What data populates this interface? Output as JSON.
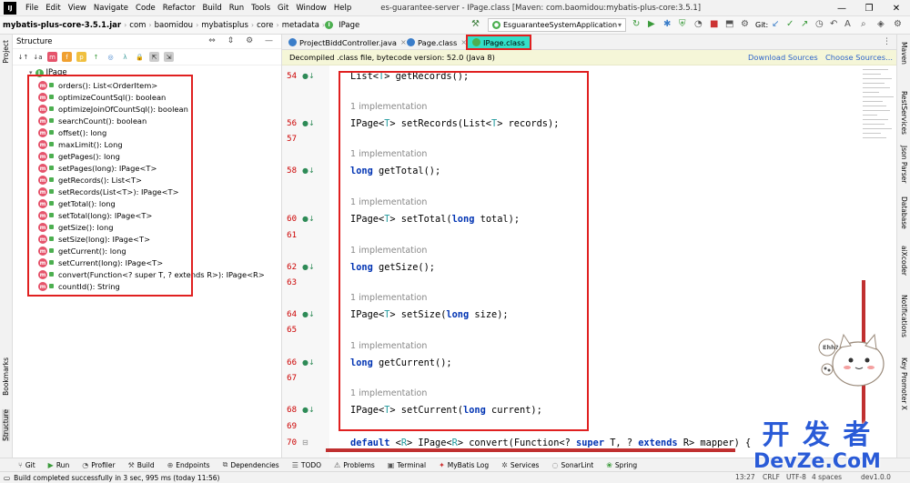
{
  "window": {
    "title": "es-guarantee-server - IPage.class [Maven: com.baomidou:mybatis-plus-core:3.5.1]",
    "menu": [
      "File",
      "Edit",
      "View",
      "Navigate",
      "Code",
      "Refactor",
      "Build",
      "Run",
      "Tools",
      "Git",
      "Window",
      "Help"
    ],
    "controls": [
      "—",
      "❐",
      "✕"
    ]
  },
  "breadcrumb": [
    "mybatis-plus-core-3.5.1.jar",
    "com",
    "baomidou",
    "mybatisplus",
    "core",
    "metadata",
    "IPage"
  ],
  "run_config": "EsguaranteeSystemApplication",
  "git_label": "Git:",
  "left_strip": [
    "Project",
    "Bookmarks",
    "Structure"
  ],
  "right_strip": [
    "Maven",
    "RestServices",
    "Json Parser",
    "Database",
    "aiXcoder",
    "Notifications",
    "Key Promoter X"
  ],
  "structure": {
    "title": "Structure",
    "root": "IPage",
    "methods": [
      "orders(): List<OrderItem>",
      "optimizeCountSql(): boolean",
      "optimizeJoinOfCountSql(): boolean",
      "searchCount(): boolean",
      "offset(): long",
      "maxLimit(): Long",
      "getPages(): long",
      "setPages(long): IPage<T>",
      "getRecords(): List<T>",
      "setRecords(List<T>): IPage<T>",
      "getTotal(): long",
      "setTotal(long): IPage<T>",
      "getSize(): long",
      "setSize(long): IPage<T>",
      "getCurrent(): long",
      "setCurrent(long): IPage<T>",
      "convert(Function<? super T, ? extends R>): IPage<R>",
      "countId(): String"
    ]
  },
  "tabs": [
    "ProjectBiddController.java",
    "Page.class",
    "IPage.class"
  ],
  "notice": {
    "text": "Decompiled .class file, bytecode version: 52.0 (Java 8)",
    "download": "Download Sources",
    "choose": "Choose Sources..."
  },
  "code": {
    "impl_hint": "1 implementation",
    "lines": [
      {
        "n": "54",
        "code": "List<T> getRecords();"
      },
      {
        "n": "56",
        "code": "IPage<T> setRecords(List<T> records);"
      },
      {
        "n": "57",
        "code": ""
      },
      {
        "n": "58",
        "code": "long getTotal();"
      },
      {
        "n": "60",
        "code": "IPage<T> setTotal(long total);"
      },
      {
        "n": "61",
        "code": ""
      },
      {
        "n": "62",
        "code": "long getSize();"
      },
      {
        "n": "63",
        "code": ""
      },
      {
        "n": "64",
        "code": "IPage<T> setSize(long size);"
      },
      {
        "n": "65",
        "code": ""
      },
      {
        "n": "66",
        "code": "long getCurrent();"
      },
      {
        "n": "67",
        "code": ""
      },
      {
        "n": "68",
        "code": "IPage<T> setCurrent(long current);"
      },
      {
        "n": "69",
        "code": ""
      },
      {
        "n": "70",
        "code": "default <R> IPage<R> convert(Function<? super T, ? extends R> mapper) {"
      }
    ]
  },
  "toolwindows": [
    "Git",
    "Run",
    "Profiler",
    "Build",
    "Endpoints",
    "Dependencies",
    "TODO",
    "Problems",
    "Terminal",
    "MyBatis Log",
    "Services",
    "SonarLint",
    "Spring"
  ],
  "status": {
    "message": "Build completed successfully in 3 sec, 995 ms (today 11:56)",
    "position": "13:27",
    "line_sep": "CRLF",
    "encoding": "UTF-8",
    "indent": "4 spaces",
    "branch": "dev1.0.0"
  },
  "watermark": {
    "cn": "开 发 者",
    "en": "DevZe.CoM"
  },
  "mascot_text": "Ehh?"
}
